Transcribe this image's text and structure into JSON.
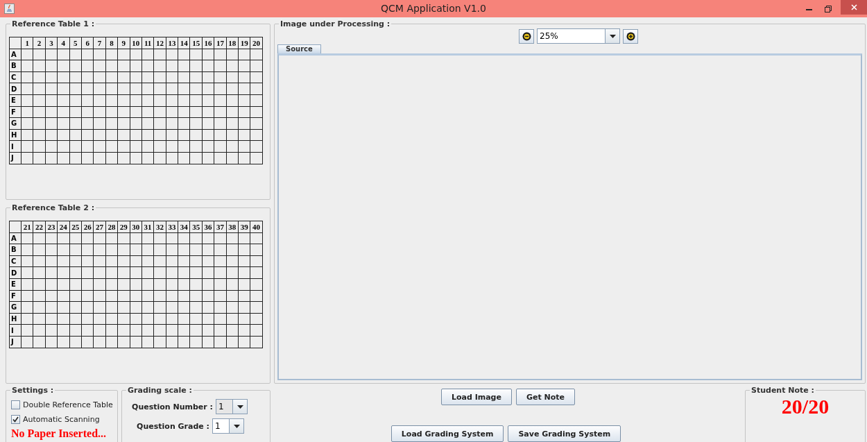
{
  "window": {
    "title": "QCM Application V1.0"
  },
  "reference_tables": [
    {
      "title": "Reference Table 1 :",
      "columns": [
        "1",
        "2",
        "3",
        "4",
        "5",
        "6",
        "7",
        "8",
        "9",
        "10",
        "11",
        "12",
        "13",
        "14",
        "15",
        "16",
        "17",
        "18",
        "19",
        "20"
      ],
      "rows": [
        "A",
        "B",
        "C",
        "D",
        "E",
        "F",
        "G",
        "H",
        "I",
        "J"
      ]
    },
    {
      "title": "Reference Table 2 :",
      "columns": [
        "21",
        "22",
        "23",
        "24",
        "25",
        "26",
        "27",
        "28",
        "29",
        "30",
        "31",
        "32",
        "33",
        "34",
        "35",
        "36",
        "37",
        "38",
        "39",
        "40"
      ],
      "rows": [
        "A",
        "B",
        "C",
        "D",
        "E",
        "F",
        "G",
        "H",
        "I",
        "J"
      ]
    }
  ],
  "image_panel": {
    "title": "Image under Processing :",
    "zoom": {
      "value": "25%",
      "editable": true
    },
    "tabs": [
      {
        "label": "Source",
        "selected": true
      }
    ]
  },
  "settings": {
    "title": "Settings :",
    "options": [
      {
        "label": "Double Reference Table",
        "checked": false
      },
      {
        "label": "Automatic Scanning",
        "checked": true
      }
    ],
    "status": "No Paper Inserted..."
  },
  "grading_scale": {
    "title": "Grading scale :",
    "fields": [
      {
        "label": "Question Number :",
        "value": "1",
        "editable": false
      },
      {
        "label": "Question Grade :",
        "value": "1",
        "editable": true
      }
    ]
  },
  "button_rows": [
    [
      "Load Image",
      "Get Note"
    ],
    [
      "Load Grading System",
      "Save Grading System"
    ]
  ],
  "student_note": {
    "title": "Student Note :",
    "value": "20/20"
  }
}
